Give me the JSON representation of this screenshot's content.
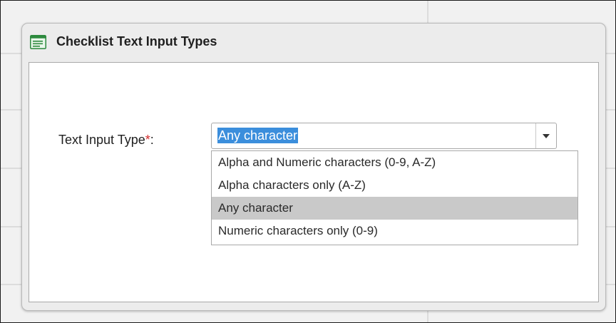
{
  "dialog": {
    "title": "Checklist Text Input Types",
    "icon": "form-list-icon"
  },
  "form": {
    "label": "Text Input Type",
    "required_marker": "*",
    "label_suffix": ":",
    "selected_value": "Any character",
    "options": [
      "Alpha and Numeric characters (0-9, A-Z)",
      "Alpha characters only (A-Z)",
      "Any character",
      "Numeric characters only (0-9)"
    ],
    "selected_index": 2
  },
  "colors": {
    "selection_highlight": "#3b8edc",
    "option_selected_bg": "#c9c9c9",
    "required_star": "#d22b2b"
  }
}
